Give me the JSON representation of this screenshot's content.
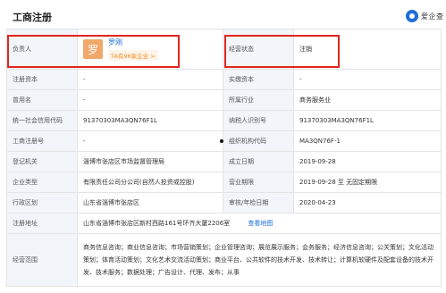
{
  "section_title": "工商注册",
  "logo": {
    "text": "爱企查",
    "icon": "aiqicha-logo-icon",
    "color": "#1e6fd8"
  },
  "representative": {
    "label": "负责人",
    "avatar_char": "罗",
    "name": "罗刚",
    "companies_tag": "TA有96家企业 >"
  },
  "status": {
    "label": "经营状态",
    "value": "注销"
  },
  "rows": [
    {
      "l1": "注册资本",
      "v1": "-",
      "l2": "实缴资本",
      "v2": "-"
    },
    {
      "l1": "曾用名",
      "v1": "-",
      "l2": "所属行业",
      "v2": "商务服务业"
    },
    {
      "l1": "统一社会信用代码",
      "v1": "91370303MA3QN76F1L",
      "l2": "纳税人识别号",
      "v2": "91370303MA3QN76F1L"
    },
    {
      "l1": "工商注册号",
      "v1": "-",
      "l2": "组织机构代码",
      "v2": "MA3QN76F-1"
    },
    {
      "l1": "登记机关",
      "v1": "淄博市张店区市场监督管理局",
      "l2": "成立日期",
      "v2": "2019-09-28"
    },
    {
      "l1": "企业类型",
      "v1": "有限责任公司分公司(自然人投资或控股)",
      "l2": "营业期限",
      "v2": "2019-09-28 至 无固定期限"
    },
    {
      "l1": "行政区划",
      "v1": "山东省淄博市张店区",
      "l2": "审核/年检日期",
      "v2": "2020-04-23"
    }
  ],
  "address": {
    "label": "注册地址",
    "value": "山东省淄博市张店区新村西路161号环齐大厦2206室",
    "link": "查看地图"
  },
  "scope": {
    "label": "经营范围",
    "value": "商务信息咨询；商业信息咨询；市场营销策划；企业管理咨询；展览展示服务；会务服务；经济信息咨询；公关策划；文化活动策划；体育活动策划；文化艺术交流活动策划；商业平台、公共软件的技术开发、技术转让；计算机软硬件及配套设备的技术开发、技术服务；数据处理；广告设计、代理、发布；从事"
  },
  "highlight_color": "#e0271f"
}
